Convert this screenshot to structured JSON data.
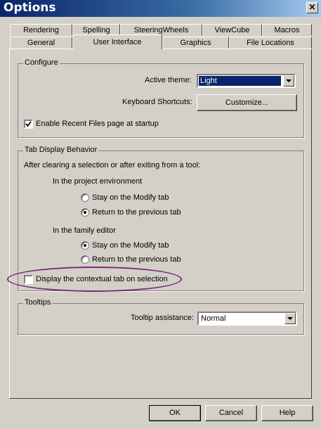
{
  "window": {
    "title": "Options",
    "close_glyph": "×"
  },
  "tabs": {
    "back_row": [
      {
        "label": "Rendering"
      },
      {
        "label": "Spelling"
      },
      {
        "label": "SteeringWheels"
      },
      {
        "label": "ViewCube"
      },
      {
        "label": "Macros"
      }
    ],
    "front_row": [
      {
        "label": "General"
      },
      {
        "label": "User Interface",
        "active": true
      },
      {
        "label": "Graphics"
      },
      {
        "label": "File Locations"
      }
    ]
  },
  "configure": {
    "label": "Configure",
    "active_theme_label": "Active theme:",
    "active_theme_value": "Light",
    "keyboard_shortcuts_label": "Keyboard Shortcuts:",
    "customize_button": "Customize...",
    "recent_files_label": "Enable Recent Files page at startup",
    "recent_files_checked": true
  },
  "tab_display": {
    "label": "Tab Display Behavior",
    "intro": "After clearing a selection or after exiting from a tool:",
    "project_env_label": "In the project environment",
    "project_options": [
      {
        "label": "Stay on the Modify tab",
        "selected": false
      },
      {
        "label": "Return to the previous tab",
        "selected": true
      }
    ],
    "family_editor_label": "In the family editor",
    "family_options": [
      {
        "label": "Stay on the Modify tab",
        "selected": true
      },
      {
        "label": "Return to the previous tab",
        "selected": false
      }
    ],
    "contextual_label": "Display the contextual tab on selection",
    "contextual_checked": false
  },
  "tooltips": {
    "label": "Tooltips",
    "assistance_label": "Tooltip assistance:",
    "assistance_value": "Normal"
  },
  "buttons": {
    "ok": "OK",
    "cancel": "Cancel",
    "help": "Help"
  },
  "colors": {
    "title_bar": "#0a246a",
    "dialog_bg": "#d4d0c8",
    "highlight_ellipse": "#7a2a7a",
    "selection": "#0a246a"
  }
}
